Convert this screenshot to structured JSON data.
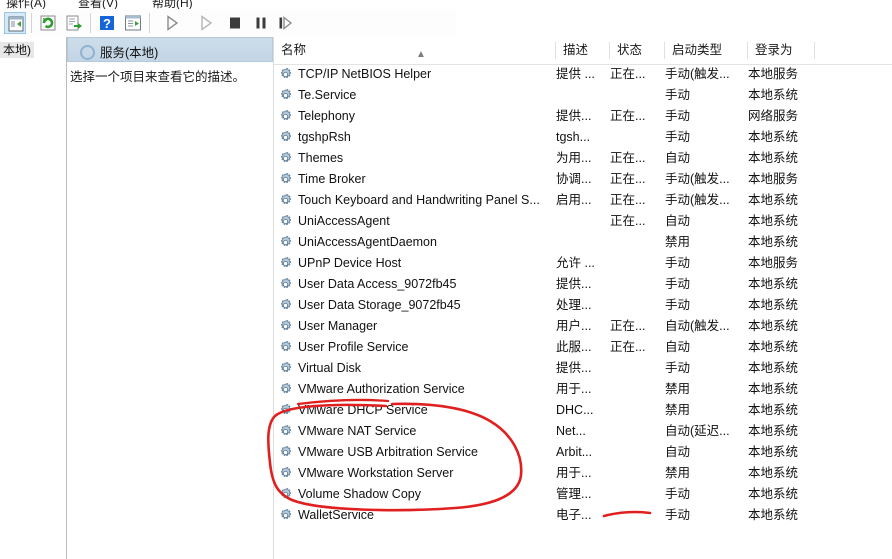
{
  "window": {
    "menu_items": [
      "操作(A)",
      "查看(V)",
      "帮助(H)"
    ],
    "tree_item_label": "本地)"
  },
  "toolbar": {
    "buttons": [
      {
        "name": "show-hide-console-tree",
        "icon": "panel-icon",
        "selected": true
      },
      {
        "name": "refresh",
        "icon": "refresh-icon",
        "selected": false
      },
      {
        "name": "export-list",
        "icon": "export-icon",
        "selected": false
      },
      {
        "name": "help",
        "icon": "help-icon",
        "selected": false
      },
      {
        "name": "properties",
        "icon": "properties-icon",
        "selected": false
      },
      {
        "name": "start-service",
        "icon": "play-icon",
        "selected": false
      },
      {
        "name": "resume-service",
        "icon": "play-gray-icon",
        "selected": false
      },
      {
        "name": "stop-service",
        "icon": "stop-icon",
        "selected": false
      },
      {
        "name": "pause-service",
        "icon": "pause-icon",
        "selected": false
      },
      {
        "name": "restart-service",
        "icon": "restart-icon",
        "selected": false
      }
    ]
  },
  "detail_pane": {
    "title": "服务(本地)",
    "hint": "选择一个项目来查看它的描述。"
  },
  "list": {
    "columns": [
      {
        "label": "名称",
        "key": "name"
      },
      {
        "label": "描述",
        "key": "description"
      },
      {
        "label": "状态",
        "key": "status"
      },
      {
        "label": "启动类型",
        "key": "startup"
      },
      {
        "label": "登录为",
        "key": "logon"
      }
    ],
    "sort_column": "名称",
    "sort_direction": "asc",
    "rows": [
      {
        "name": "TCP/IP NetBIOS Helper",
        "description": "提供 ...",
        "status": "正在...",
        "startup": "手动(触发...",
        "logon": "本地服务"
      },
      {
        "name": "Te.Service",
        "description": "",
        "status": "",
        "startup": "手动",
        "logon": "本地系统"
      },
      {
        "name": "Telephony",
        "description": "提供...",
        "status": "正在...",
        "startup": "手动",
        "logon": "网络服务"
      },
      {
        "name": "tgshpRsh",
        "description": "tgsh...",
        "status": "",
        "startup": "手动",
        "logon": "本地系统"
      },
      {
        "name": "Themes",
        "description": "为用...",
        "status": "正在...",
        "startup": "自动",
        "logon": "本地系统"
      },
      {
        "name": "Time Broker",
        "description": "协调...",
        "status": "正在...",
        "startup": "手动(触发...",
        "logon": "本地服务"
      },
      {
        "name": "Touch Keyboard and Handwriting Panel S...",
        "description": "启用...",
        "status": "正在...",
        "startup": "手动(触发...",
        "logon": "本地系统"
      },
      {
        "name": "UniAccessAgent",
        "description": "",
        "status": "正在...",
        "startup": "自动",
        "logon": "本地系统"
      },
      {
        "name": "UniAccessAgentDaemon",
        "description": "",
        "status": "",
        "startup": "禁用",
        "logon": "本地系统"
      },
      {
        "name": "UPnP Device Host",
        "description": "允许 ...",
        "status": "",
        "startup": "手动",
        "logon": "本地服务"
      },
      {
        "name": "User Data Access_9072fb45",
        "description": "提供...",
        "status": "",
        "startup": "手动",
        "logon": "本地系统"
      },
      {
        "name": "User Data Storage_9072fb45",
        "description": "处理...",
        "status": "",
        "startup": "手动",
        "logon": "本地系统"
      },
      {
        "name": "User Manager",
        "description": "用户...",
        "status": "正在...",
        "startup": "自动(触发...",
        "logon": "本地系统"
      },
      {
        "name": "User Profile Service",
        "description": "此服...",
        "status": "正在...",
        "startup": "自动",
        "logon": "本地系统"
      },
      {
        "name": "Virtual Disk",
        "description": "提供...",
        "status": "",
        "startup": "手动",
        "logon": "本地系统"
      },
      {
        "name": "VMware Authorization Service",
        "description": "用于...",
        "status": "",
        "startup": "禁用",
        "logon": "本地系统"
      },
      {
        "name": "VMware DHCP Service",
        "description": "DHC...",
        "status": "",
        "startup": "禁用",
        "logon": "本地系统"
      },
      {
        "name": "VMware NAT Service",
        "description": "Net...",
        "status": "",
        "startup": "自动(延迟...",
        "logon": "本地系统"
      },
      {
        "name": "VMware USB Arbitration Service",
        "description": "Arbit...",
        "status": "",
        "startup": "自动",
        "logon": "本地系统"
      },
      {
        "name": "VMware Workstation Server",
        "description": "用于...",
        "status": "",
        "startup": "禁用",
        "logon": "本地系统"
      },
      {
        "name": "Volume Shadow Copy",
        "description": "管理...",
        "status": "",
        "startup": "手动",
        "logon": "本地系统"
      },
      {
        "name": "WalletService",
        "description": "电子...",
        "status": "",
        "startup": "手动",
        "logon": "本地系统"
      }
    ]
  },
  "annotations": {
    "ink_color": "#e02020",
    "ellipse_label": "circled-vmware-services",
    "underline_label": "underlined-startup-type"
  }
}
